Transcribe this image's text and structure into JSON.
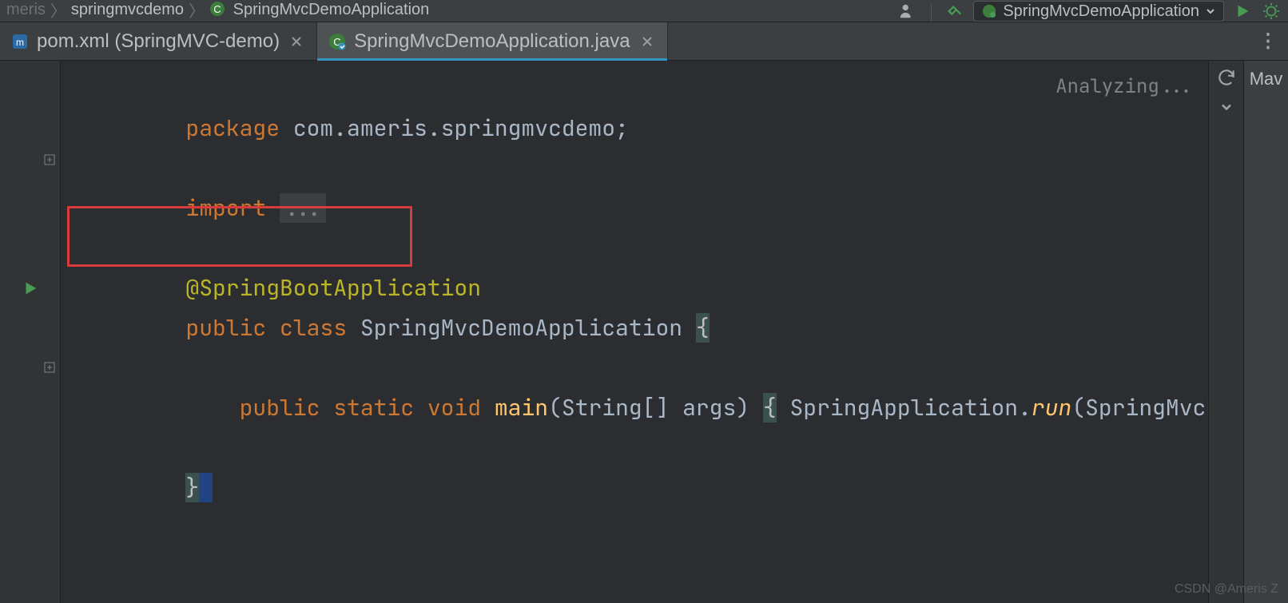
{
  "breadcrumb": {
    "seg1_partial": "meris",
    "seg2": "springmvcdemo",
    "seg3": "SpringMvcDemoApplication"
  },
  "runConfig": {
    "name": "SpringMvcDemoApplication"
  },
  "tabs": {
    "pom": {
      "label": "pom.xml (SpringMVC-demo)"
    },
    "app": {
      "label": "SpringMvcDemoApplication.java"
    },
    "overflow": "⋮"
  },
  "editor": {
    "status": "Analyzing...",
    "lines": {
      "l1": {
        "kw": "package",
        "rest": " com.ameris.springmvcdemo;"
      },
      "l3_kw": "import",
      "l3_dots": "...",
      "l5_ann": "@SpringBootApplication",
      "l6": {
        "public": "public",
        "class": "class",
        "name": " SpringMvcDemoApplication ",
        "brace": "{"
      },
      "l8": {
        "indent": "    ",
        "public": "public",
        "static": "static",
        "void": "void",
        "main": " main",
        "args": "(String[] args) ",
        "brace": "{",
        "call1": " SpringApplication.",
        "run": "run",
        "call2": "(SpringMvcDemoA"
      },
      "l10_brace": "}"
    }
  },
  "rightTool": {
    "maven": "Mav"
  },
  "watermark": "CSDN @Ameris Z"
}
